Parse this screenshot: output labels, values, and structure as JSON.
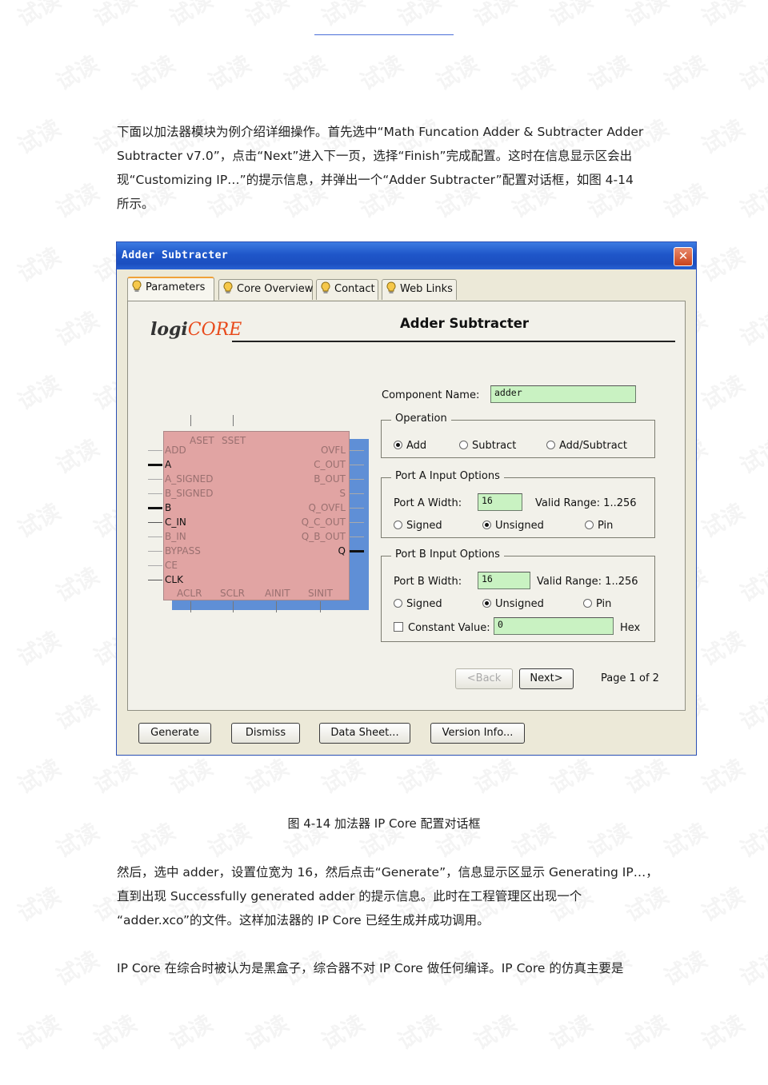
{
  "watermark": "试读",
  "paragraphs": {
    "intro": [
      "下面以加法器模块为例介绍详细操作。首先选中“Math Funcation Adder & Subtracter Adder",
      "Subtracter v7.0”，点击“Next”进入下一页，选择“Finish”完成配置。这时在信息显示区会出",
      "现“Customizing IP…”的提示信息，并弹出一个“Adder Subtracter”配置对话框，如图 4-14",
      "所示。"
    ],
    "after": [
      "然后，选中 adder，设置位宽为 16，然后点击“Generate”，信息显示区显示 Generating IP…，",
      "直到出现 Successfully generated adder 的提示信息。此时在工程管理区出现一个",
      "“adder.xco”的文件。这样加法器的 IP Core 已经生成并成功调用。"
    ],
    "last": [
      "IP Core 在综合时被认为是黑盒子，综合器不对 IP Core 做任何编译。IP Core 的仿真主要是"
    ]
  },
  "caption": "图 4-14  加法器 IP Core 配置对话框",
  "dialog": {
    "title": "Adder Subtracter",
    "close_glyph": "✕",
    "tabs": [
      "Parameters",
      "Core Overview",
      "Contact",
      "Web Links"
    ],
    "logo_left": "logi",
    "logo_right": "CORE",
    "heading": "Adder Subtracter",
    "component_name_label": "Component Name:",
    "component_name_value": "adder",
    "operation": {
      "title": "Operation",
      "options": [
        "Add",
        "Subtract",
        "Add/Subtract"
      ],
      "selected": "Add"
    },
    "port_a": {
      "title": "Port A Input Options",
      "width_label": "Port A Width:",
      "width_value": "16",
      "range": "Valid Range: 1..256",
      "options": [
        "Signed",
        "Unsigned",
        "Pin"
      ],
      "selected": "Unsigned"
    },
    "port_b": {
      "title": "Port B Input Options",
      "width_label": "Port B Width:",
      "width_value": "16",
      "range": "Valid Range: 1..256",
      "options": [
        "Signed",
        "Unsigned",
        "Pin"
      ],
      "selected": "Unsigned",
      "constant_label": "Constant Value:",
      "constant_value": "0",
      "hex": "Hex"
    },
    "nav": {
      "back": "<Back",
      "next": "Next>",
      "page": "Page 1 of 2"
    },
    "buttons": [
      "Generate",
      "Dismiss",
      "Data Sheet...",
      "Version Info..."
    ],
    "symbol": {
      "top_pins": [
        "ASET",
        "SSET"
      ],
      "bottom_pins": [
        "ACLR",
        "SCLR",
        "AINIT",
        "SINIT"
      ],
      "left_pins": [
        "ADD",
        "A",
        "A_SIGNED",
        "B_SIGNED",
        "B",
        "C_IN",
        "B_IN",
        "BYPASS",
        "CE",
        "CLK"
      ],
      "left_active": [
        "A",
        "B",
        "C_IN",
        "CLK"
      ],
      "right_pins": [
        "OVFL",
        "C_OUT",
        "B_OUT",
        "S",
        "Q_OVFL",
        "Q_C_OUT",
        "Q_B_OUT",
        "Q"
      ],
      "right_active": [
        "Q"
      ]
    }
  }
}
